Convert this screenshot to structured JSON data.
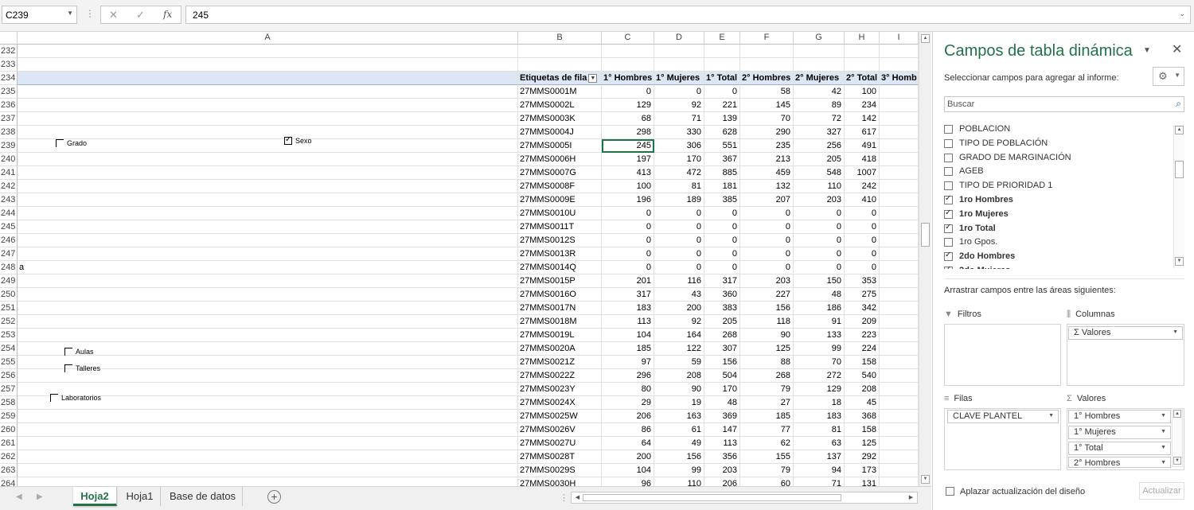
{
  "formula_bar": {
    "name_box": "C239",
    "fx_label": "fx",
    "cancel_symbol": "✕",
    "enter_symbol": "✓",
    "content": "245"
  },
  "columns": [
    "A",
    "B",
    "C",
    "D",
    "E",
    "F",
    "G",
    "H",
    "I"
  ],
  "sheet": {
    "rows": [
      {
        "n": "232",
        "a": "",
        "cells": null
      },
      {
        "n": "233",
        "a": "",
        "cells": null
      },
      {
        "n": "234",
        "a": "",
        "header": true,
        "cells": [
          "Etiquetas de fila",
          "1° Hombres",
          "1° Mujeres",
          "1° Total",
          "2° Hombres",
          "2° Mujeres",
          "2° Total",
          "3° Homb"
        ]
      },
      {
        "n": "235",
        "a": "",
        "cells": [
          "27MMS0001M",
          "0",
          "0",
          "0",
          "58",
          "42",
          "100",
          ""
        ]
      },
      {
        "n": "236",
        "a": "",
        "cells": [
          "27MMS0002L",
          "129",
          "92",
          "221",
          "145",
          "89",
          "234",
          ""
        ]
      },
      {
        "n": "237",
        "a": "",
        "cells": [
          "27MMS0003K",
          "68",
          "71",
          "139",
          "70",
          "72",
          "142",
          ""
        ]
      },
      {
        "n": "238",
        "a": "",
        "cells": [
          "27MMS0004J",
          "298",
          "330",
          "628",
          "290",
          "327",
          "617",
          ""
        ]
      },
      {
        "n": "239",
        "a": "",
        "cells": [
          "27MMS0005I",
          "245",
          "306",
          "551",
          "235",
          "256",
          "491",
          ""
        ]
      },
      {
        "n": "240",
        "a": "",
        "cells": [
          "27MMS0006H",
          "197",
          "170",
          "367",
          "213",
          "205",
          "418",
          ""
        ]
      },
      {
        "n": "241",
        "a": "",
        "cells": [
          "27MMS0007G",
          "413",
          "472",
          "885",
          "459",
          "548",
          "1007",
          ""
        ]
      },
      {
        "n": "242",
        "a": "",
        "cells": [
          "27MMS0008F",
          "100",
          "81",
          "181",
          "132",
          "110",
          "242",
          ""
        ]
      },
      {
        "n": "243",
        "a": "",
        "cells": [
          "27MMS0009E",
          "196",
          "189",
          "385",
          "207",
          "203",
          "410",
          ""
        ]
      },
      {
        "n": "244",
        "a": "",
        "cells": [
          "27MMS0010U",
          "0",
          "0",
          "0",
          "0",
          "0",
          "0",
          ""
        ]
      },
      {
        "n": "245",
        "a": "",
        "cells": [
          "27MMS0011T",
          "0",
          "0",
          "0",
          "0",
          "0",
          "0",
          ""
        ]
      },
      {
        "n": "246",
        "a": "",
        "cells": [
          "27MMS0012S",
          "0",
          "0",
          "0",
          "0",
          "0",
          "0",
          ""
        ]
      },
      {
        "n": "247",
        "a": "",
        "cells": [
          "27MMS0013R",
          "0",
          "0",
          "0",
          "0",
          "0",
          "0",
          ""
        ]
      },
      {
        "n": "248",
        "a": "a",
        "cells": [
          "27MMS0014Q",
          "0",
          "0",
          "0",
          "0",
          "0",
          "0",
          ""
        ]
      },
      {
        "n": "249",
        "a": "",
        "cells": [
          "27MMS0015P",
          "201",
          "116",
          "317",
          "203",
          "150",
          "353",
          ""
        ]
      },
      {
        "n": "250",
        "a": "",
        "cells": [
          "27MMS0016O",
          "317",
          "43",
          "360",
          "227",
          "48",
          "275",
          ""
        ]
      },
      {
        "n": "251",
        "a": "",
        "cells": [
          "27MMS0017N",
          "183",
          "200",
          "383",
          "156",
          "186",
          "342",
          ""
        ]
      },
      {
        "n": "252",
        "a": "",
        "cells": [
          "27MMS0018M",
          "113",
          "92",
          "205",
          "118",
          "91",
          "209",
          ""
        ]
      },
      {
        "n": "253",
        "a": "",
        "cells": [
          "27MMS0019L",
          "104",
          "164",
          "268",
          "90",
          "133",
          "223",
          ""
        ]
      },
      {
        "n": "254",
        "a": "",
        "cells": [
          "27MMS0020A",
          "185",
          "122",
          "307",
          "125",
          "99",
          "224",
          ""
        ]
      },
      {
        "n": "255",
        "a": "",
        "cells": [
          "27MMS0021Z",
          "97",
          "59",
          "156",
          "88",
          "70",
          "158",
          ""
        ]
      },
      {
        "n": "256",
        "a": "",
        "cells": [
          "27MMS0022Z",
          "296",
          "208",
          "504",
          "268",
          "272",
          "540",
          ""
        ]
      },
      {
        "n": "257",
        "a": "",
        "cells": [
          "27MMS0023Y",
          "80",
          "90",
          "170",
          "79",
          "129",
          "208",
          ""
        ]
      },
      {
        "n": "258",
        "a": "",
        "cells": [
          "27MMS0024X",
          "29",
          "19",
          "48",
          "27",
          "18",
          "45",
          ""
        ]
      },
      {
        "n": "259",
        "a": "",
        "cells": [
          "27MMS0025W",
          "206",
          "163",
          "369",
          "185",
          "183",
          "368",
          ""
        ]
      },
      {
        "n": "260",
        "a": "",
        "cells": [
          "27MMS0026V",
          "86",
          "61",
          "147",
          "77",
          "81",
          "158",
          ""
        ]
      },
      {
        "n": "261",
        "a": "",
        "cells": [
          "27MMS0027U",
          "64",
          "49",
          "113",
          "62",
          "63",
          "125",
          ""
        ]
      },
      {
        "n": "262",
        "a": "",
        "cells": [
          "27MMS0028T",
          "200",
          "156",
          "356",
          "155",
          "137",
          "292",
          ""
        ]
      },
      {
        "n": "263",
        "a": "",
        "cells": [
          "27MMS0029S",
          "104",
          "99",
          "203",
          "79",
          "94",
          "173",
          ""
        ]
      },
      {
        "n": "264",
        "a": "",
        "cells": [
          "27MMS0030H",
          "96",
          "110",
          "206",
          "60",
          "71",
          "131",
          ""
        ]
      }
    ]
  },
  "form_controls": [
    {
      "label": "Grado",
      "checked": false
    },
    {
      "label": "Sexo",
      "checked": true
    },
    {
      "label": "Aulas",
      "checked": false
    },
    {
      "label": "Talleres",
      "checked": false
    },
    {
      "label": "Laboratorios",
      "checked": false
    }
  ],
  "sheet_tabs": [
    "Hoja2",
    "Hoja1",
    "Base de datos"
  ],
  "active_tab": "Hoja2",
  "pivot_pane": {
    "title": "Campos de tabla dinámica",
    "subtitle": "Seleccionar campos para agregar al informe:",
    "search_placeholder": "Buscar",
    "fields": [
      {
        "label": "POBLACION",
        "checked": false
      },
      {
        "label": "TIPO DE POBLACIÓN",
        "checked": false
      },
      {
        "label": "GRADO DE MARGINACIÓN",
        "checked": false
      },
      {
        "label": "AGEB",
        "checked": false
      },
      {
        "label": "TIPO DE PRIORIDAD 1",
        "checked": false
      },
      {
        "label": "1ro Hombres",
        "checked": true
      },
      {
        "label": "1ro Mujeres",
        "checked": true
      },
      {
        "label": "1ro Total",
        "checked": true
      },
      {
        "label": "1ro Gpos.",
        "checked": false
      },
      {
        "label": "2do Hombres",
        "checked": true
      },
      {
        "label": "2do Mujeres",
        "checked": true
      }
    ],
    "drag_text": "Arrastrar campos entre las áreas siguientes:",
    "areas": {
      "filters_label": "Filtros",
      "columns_label": "Columnas",
      "rows_label": "Filas",
      "values_label": "Valores",
      "columns_items": [
        "Σ Valores"
      ],
      "rows_items": [
        "CLAVE PLANTEL"
      ],
      "values_items": [
        "1° Hombres",
        "1° Mujeres",
        "1° Total",
        "2° Hombres"
      ]
    },
    "defer_label": "Aplazar actualización del diseño",
    "update_label": "Actualizar"
  }
}
